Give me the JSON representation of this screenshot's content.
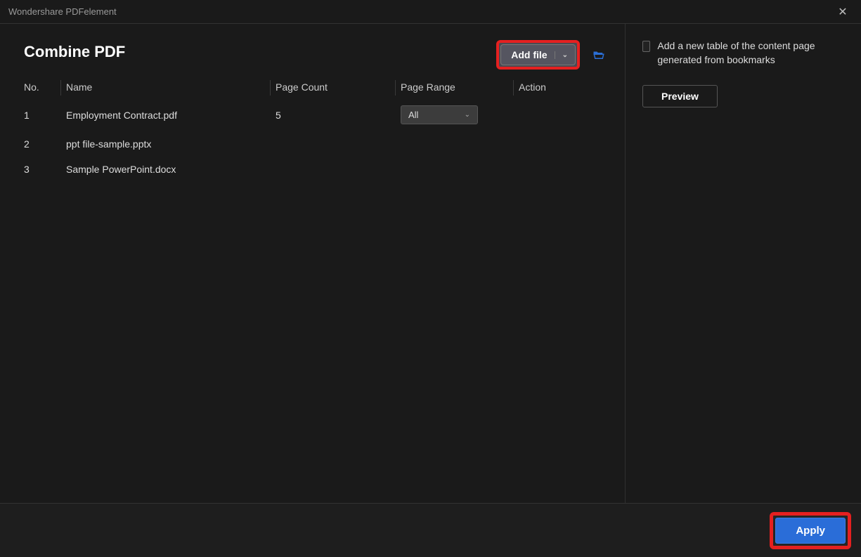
{
  "app_title": "Wondershare PDFelement",
  "page_title": "Combine PDF",
  "add_file_label": "Add file",
  "columns": {
    "no": "No.",
    "name": "Name",
    "page_count": "Page Count",
    "page_range": "Page Range",
    "action": "Action"
  },
  "rows": [
    {
      "no": "1",
      "name": "Employment Contract.pdf",
      "page_count": "5",
      "page_range": "All"
    },
    {
      "no": "2",
      "name": "ppt file-sample.pptx",
      "page_count": "",
      "page_range": ""
    },
    {
      "no": "3",
      "name": "Sample PowerPoint.docx",
      "page_count": "",
      "page_range": ""
    }
  ],
  "sidebar": {
    "toc_checkbox_label": "Add a new table of the content page generated from bookmarks",
    "preview_label": "Preview"
  },
  "footer": {
    "apply_label": "Apply"
  },
  "icons": {
    "close": "✕",
    "caret_down": "⌄",
    "folder": "folder-open-icon"
  }
}
